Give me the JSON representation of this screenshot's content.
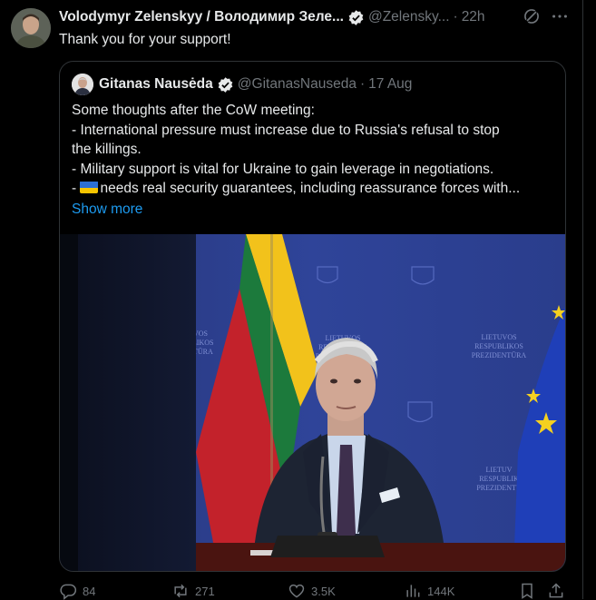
{
  "post": {
    "author_name": "Volodymyr Zelenskyy / Володимир Зеле...",
    "author_handle": "@Zelensky...",
    "separator": "·",
    "time": "22h",
    "text": "Thank you for your support!"
  },
  "quote": {
    "author_name": "Gitanas Nausėda",
    "author_handle": "@GitanasNauseda",
    "separator": "·",
    "date": "17 Aug",
    "lines": [
      "Some thoughts after the CoW meeting:",
      "- International pressure must increase due to Russia's refusal to stop",
      "the killings.",
      "- Military support is vital for Ukraine to gain leverage in negotiations.",
      "- ",
      "needs real security guarantees, including reassurance forces with..."
    ],
    "show_more": "Show more",
    "image_texts": {
      "left_sign": "…VOS\n…BLIKOS\n…NTŪRA",
      "center_sign": "LIETUVOS\nRESPUBLIKOS\nPREZIDENTŪRA",
      "right_sign": "LIETUVOS\nRESPUBLIKOS\nPREZIDENTŪRA",
      "right_sign_low": "LIETUV…\nRESPUBLIK…\nPREZIDENTŪ…"
    }
  },
  "actions": {
    "replies": "84",
    "reposts": "271",
    "likes": "3.5K",
    "views": "144K"
  },
  "colors": {
    "background": "#000000",
    "text": "#e7e9ea",
    "muted": "#71767b",
    "link": "#1d9bf0",
    "verified": "#e7e9ea",
    "border": "#2f3336"
  },
  "icons": [
    "verified-badge-icon",
    "grok-icon",
    "more-icon",
    "reply-icon",
    "repost-icon",
    "like-icon",
    "views-icon",
    "bookmark-icon",
    "share-icon",
    "ukraine-flag-icon"
  ]
}
